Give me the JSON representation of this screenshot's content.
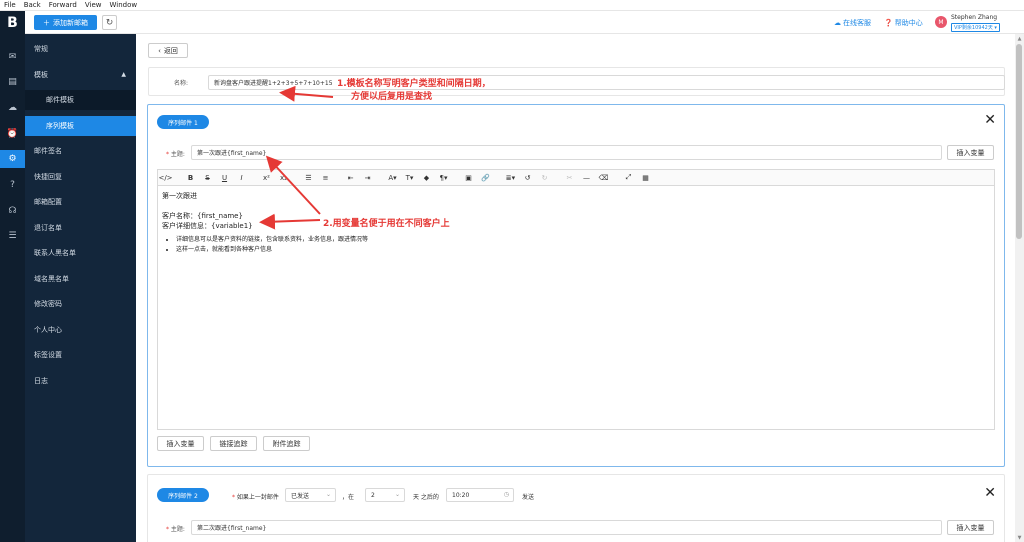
{
  "os_menu": [
    "File",
    "Back",
    "Forward",
    "View",
    "Window"
  ],
  "header": {
    "logo": "B",
    "add_button": "添加新邮箱",
    "online_service": "在线客服",
    "help_center": "帮助中心",
    "user_initial": "M",
    "user_name": "Stephen Zhang",
    "vip_label": "VIP剩余10942天"
  },
  "sidebar": {
    "items": [
      {
        "label": "常规"
      },
      {
        "label": "模板"
      },
      {
        "label": "邮件模板"
      },
      {
        "label": "序列模板"
      },
      {
        "label": "邮件签名"
      },
      {
        "label": "快捷回复"
      },
      {
        "label": "邮箱配置"
      },
      {
        "label": "退订名单"
      },
      {
        "label": "联系人黑名单"
      },
      {
        "label": "域名黑名单"
      },
      {
        "label": "修改密码"
      },
      {
        "label": "个人中心"
      },
      {
        "label": "标签设置"
      },
      {
        "label": "日志"
      }
    ]
  },
  "main": {
    "back_label": "返回",
    "name_label": "名称:",
    "name_value": "新询盘客户跟进提醒1+2+3+5+7+10+15",
    "seq1": {
      "pill": "序列邮件 1",
      "subject_label": "主题:",
      "subject_value": "第一次跟进{first_name}",
      "insert_var": "插入变量",
      "editor": {
        "line1": "第一次跟进",
        "line2": "客户名称：{first_name}",
        "line3": "客户详细信息：{variable1}",
        "bullet1": "详细信息可以是客户资料的链接，包含联系资料，业务信息，跟进情况等",
        "bullet2": "这样一点击，就能看到各种客户信息"
      },
      "btn_insert_var": "插入变量",
      "btn_link_track": "链接追踪",
      "btn_attach_track": "附件追踪"
    },
    "seq2": {
      "pill": "序列邮件 2",
      "cond_prefix": "如果上一封邮件",
      "status_value": "已发送",
      "cond_at": "，在",
      "days_value": "2",
      "cond_days_after": "天 之后的",
      "time_value": "10:20",
      "cond_send": "发送",
      "subject_label": "主题:",
      "subject_value": "第二次跟进{first_name}",
      "insert_var": "插入变量"
    }
  },
  "annotations": {
    "note1_line1": "1.模板名称写明客户类型和间隔日期，",
    "note1_line2": "方便以后复用是查找",
    "note2": "2.用变量名便于用在不同客户上",
    "color": "#e53935"
  },
  "colors": {
    "accent": "#1e88e5",
    "sidebar_bg": "#13263b",
    "rail_bg": "#0f1e2e"
  }
}
